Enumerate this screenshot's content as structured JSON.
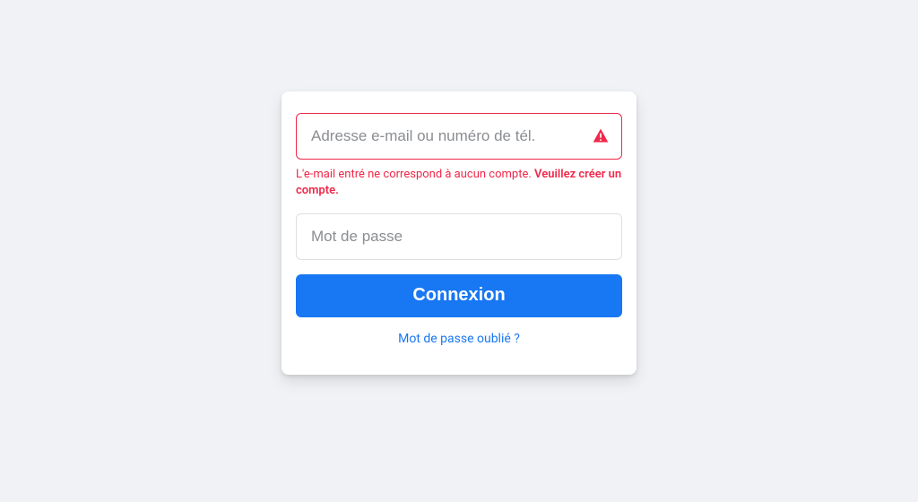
{
  "form": {
    "email": {
      "placeholder": "Adresse e-mail ou numéro de tél.",
      "value": "",
      "error_prefix": "L'e-mail entré ne correspond à aucun compte. ",
      "error_bold": "Veuillez créer un compte."
    },
    "password": {
      "placeholder": "Mot de passe",
      "value": ""
    },
    "login_button": "Connexion",
    "forgot_link": "Mot de passe oublié ?"
  },
  "colors": {
    "primary": "#1877f2",
    "error": "#f02849",
    "background": "#f0f2f5"
  }
}
